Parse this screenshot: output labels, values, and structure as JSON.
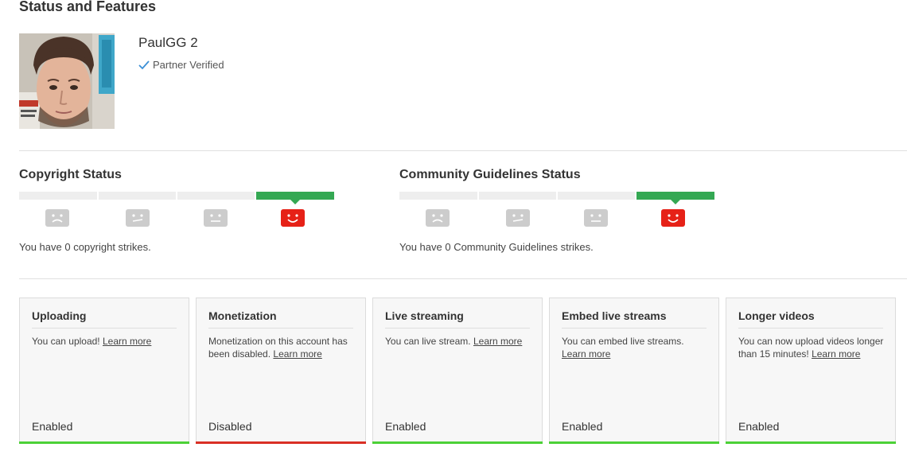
{
  "header": {
    "title": "Status and Features"
  },
  "channel": {
    "name": "PaulGG 2",
    "verified_label": "Partner Verified"
  },
  "copyright": {
    "title": "Copyright Status",
    "text": "You have 0 copyright strikes.",
    "active_segment": 4
  },
  "community": {
    "title": "Community Guidelines Status",
    "text": "You have 0 Community Guidelines strikes.",
    "active_segment": 4
  },
  "features": [
    {
      "title": "Uploading",
      "desc": "You can upload!",
      "link": "Learn more",
      "state": "Enabled"
    },
    {
      "title": "Monetization",
      "desc": "Monetization on this account has been disabled.",
      "link": "Learn more",
      "state": "Disabled"
    },
    {
      "title": "Live streaming",
      "desc": "You can live stream.",
      "link": "Learn more",
      "state": "Enabled"
    },
    {
      "title": "Embed live streams",
      "desc": "You can embed live streams.",
      "link": "Learn more",
      "state": "Enabled"
    },
    {
      "title": "Longer videos",
      "desc": "You can now upload videos longer than 15 minutes!",
      "link": "Learn more",
      "state": "Enabled"
    }
  ],
  "colors": {
    "enabled": "#4cd137",
    "disabled": "#d93025",
    "active_strike": "#34a853",
    "smile_face": "#e62117",
    "inactive_face": "#cccccc"
  },
  "icons": {
    "verified": "checkmark-icon",
    "faces": [
      "sad-face-icon",
      "skeptical-face-icon",
      "neutral-face-icon",
      "happy-face-icon"
    ]
  }
}
